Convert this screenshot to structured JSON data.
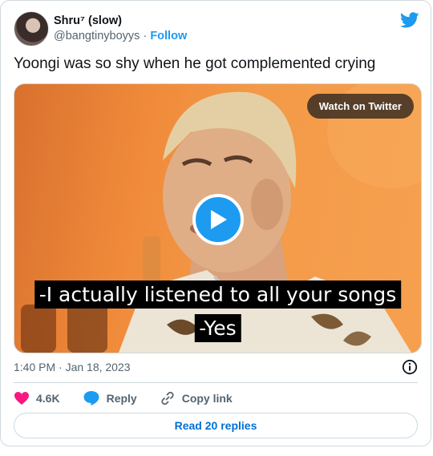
{
  "user": {
    "display_name": "Shru⁷ (slow)",
    "handle": "@bangtinyboyys",
    "separator": " · ",
    "follow_label": "Follow"
  },
  "tweet": {
    "text": "Yoongi was so shy when he got complemented crying",
    "timestamp": "1:40 PM · Jan 18, 2023"
  },
  "media": {
    "watch_label": "Watch on Twitter",
    "caption_line1": "-I actually listened to all your songs",
    "caption_line2": "-Yes"
  },
  "actions": {
    "like_count": "4.6K",
    "reply_label": "Reply",
    "copy_label": "Copy link"
  },
  "replies_button": "Read 20 replies",
  "colors": {
    "brand_blue": "#1d9bf0",
    "like_pink": "#f91880",
    "link_blue": "#006fd6",
    "text_dark": "#0f1419",
    "text_gray": "#536471"
  },
  "icons": [
    "twitter-logo-icon",
    "play-icon",
    "info-icon",
    "heart-icon",
    "reply-bubble-icon",
    "link-icon"
  ]
}
